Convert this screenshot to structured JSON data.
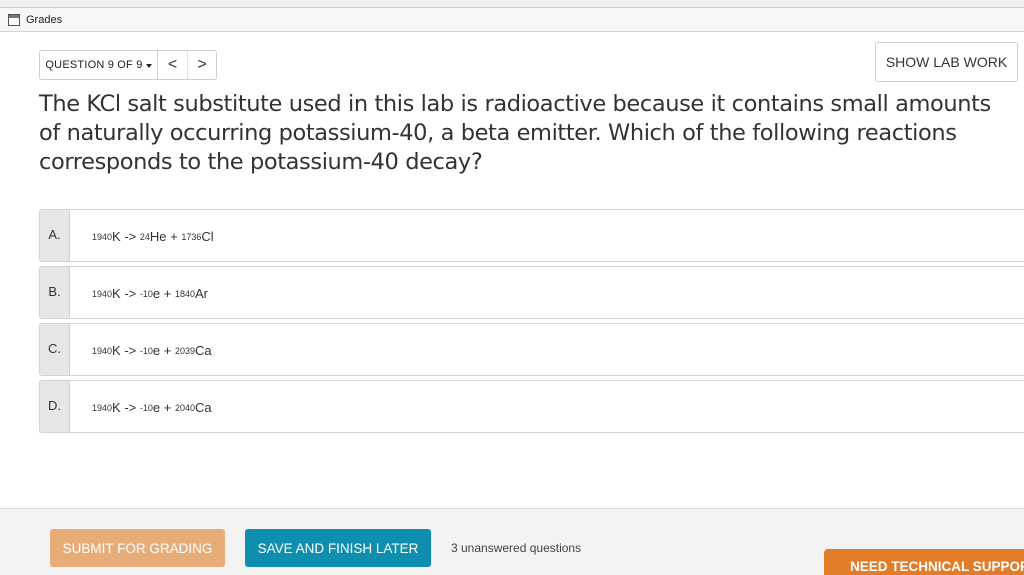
{
  "bookmarks": {
    "item_label": "Grades",
    "item_icon": "folder-icon"
  },
  "question_nav": {
    "selector_label": "QUESTION 9 OF 9",
    "prev_label": "<",
    "next_label": ">"
  },
  "lab_work_label": "SHOW LAB WORK",
  "question_text": "The KCl salt substitute used in this lab is radioactive because it contains small amounts of naturally occurring potassium-40, a beta emitter. Which of the following reactions corresponds to the potassium-40 decay?",
  "options": [
    {
      "letter": "A.",
      "k_z": "19",
      "k_a": "40",
      "k_sym": "K",
      "arrow": "->",
      "p1_z": "2",
      "p1_a": "4",
      "p1_sym": "He",
      "plus": "+",
      "p2_z": "17",
      "p2_a": "36",
      "p2_sym": "Cl"
    },
    {
      "letter": "B.",
      "k_z": "19",
      "k_a": "40",
      "k_sym": "K",
      "arrow": "->",
      "p1_z": "-1",
      "p1_a": "0",
      "p1_sym": "e",
      "plus": "+",
      "p2_z": "18",
      "p2_a": "40",
      "p2_sym": "Ar"
    },
    {
      "letter": "C.",
      "k_z": "19",
      "k_a": "40",
      "k_sym": "K",
      "arrow": "->",
      "p1_z": "-1",
      "p1_a": "0",
      "p1_sym": "e",
      "plus": "+",
      "p2_z": "20",
      "p2_a": "39",
      "p2_sym": "Ca"
    },
    {
      "letter": "D.",
      "k_z": "19",
      "k_a": "40",
      "k_sym": "K",
      "arrow": "->",
      "p1_z": "-1",
      "p1_a": "0",
      "p1_sym": "e",
      "plus": "+",
      "p2_z": "20",
      "p2_a": "40",
      "p2_sym": "Ca"
    }
  ],
  "footer": {
    "submit_label": "SUBMIT FOR GRADING",
    "save_label": "SAVE AND FINISH LATER",
    "unanswered_text": "3 unanswered questions",
    "support_label": "NEED TECHNICAL SUPPORT?"
  },
  "colors": {
    "submit": "#e7ad78",
    "save": "#0f8fb0",
    "support": "#e27c27"
  }
}
